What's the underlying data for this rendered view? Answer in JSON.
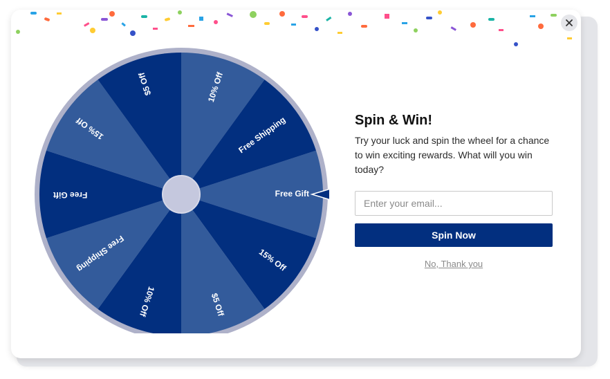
{
  "popup": {
    "title": "Spin & Win!",
    "description": "Try your luck and spin the wheel for a chance to win exciting rewards. What will you win today?",
    "email_placeholder": "Enter your email...",
    "email_value": "",
    "spin_button_label": "Spin Now",
    "decline_link_label": "No, Thank you",
    "close_icon": "close-icon"
  },
  "wheel": {
    "segments": [
      "Free Gift",
      "15% Off",
      "$5 Off",
      "10% Off",
      "Free Shipping",
      "Free Gift",
      "15% Off",
      "$5 Off",
      "10% Off",
      "Free Shipping"
    ],
    "pointer_icon": "pointer-icon",
    "colors": {
      "dark": "#022f7f",
      "light": "#335b9b",
      "rim": "#aeb1c9",
      "hub": "#c5c8de",
      "accent": "#022f7f"
    }
  }
}
